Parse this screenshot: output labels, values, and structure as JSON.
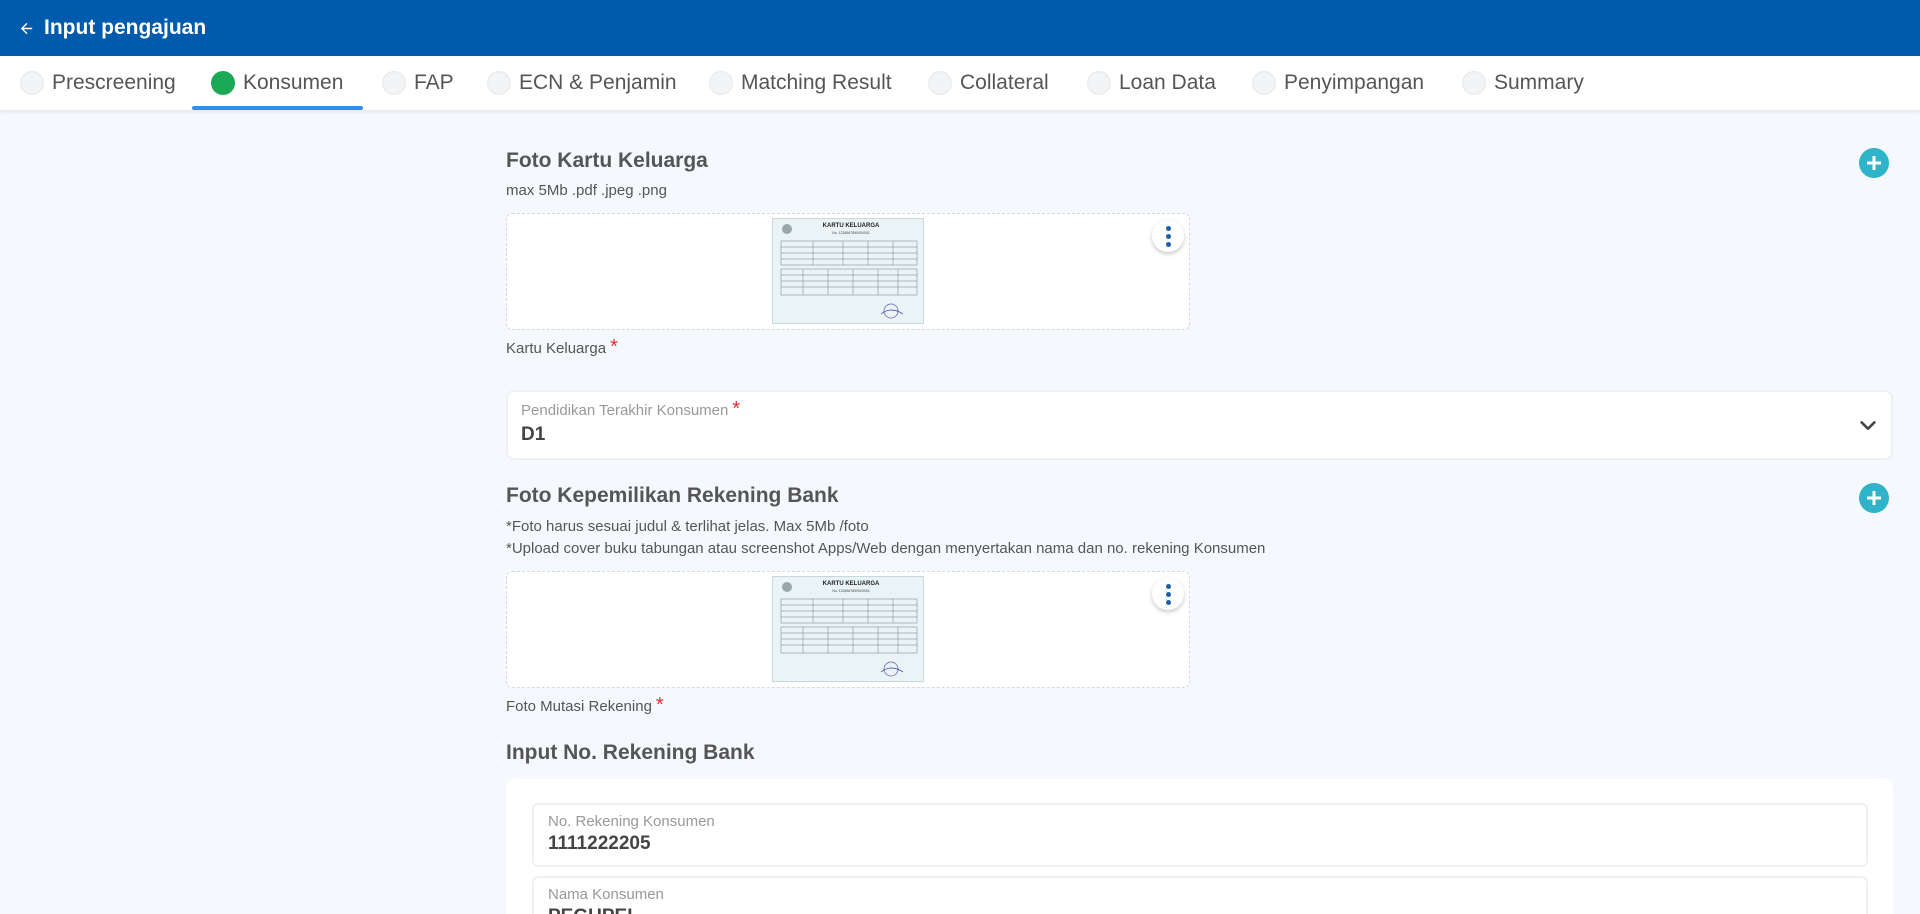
{
  "header": {
    "title": "Input pengajuan"
  },
  "tabs": [
    {
      "label": "Prescreening",
      "active": false
    },
    {
      "label": "Konsumen",
      "active": true
    },
    {
      "label": "FAP",
      "active": false
    },
    {
      "label": "ECN & Penjamin",
      "active": false
    },
    {
      "label": "Matching Result",
      "active": false
    },
    {
      "label": "Collateral",
      "active": false
    },
    {
      "label": "Loan Data",
      "active": false
    },
    {
      "label": "Penyimpangan",
      "active": false
    },
    {
      "label": "Summary",
      "active": false
    }
  ],
  "kk_section": {
    "title": "Foto Kartu Keluarga",
    "hint": "max 5Mb .pdf .jpeg .png",
    "caption": "Kartu Keluarga",
    "required_mark": "*"
  },
  "pendidikan": {
    "label": "Pendidikan Terakhir Konsumen",
    "required_mark": "*",
    "value": "D1"
  },
  "rekening_section": {
    "title": "Foto Kepemilikan Rekening Bank",
    "hint_1": "*Foto harus sesuai judul & terlihat jelas. Max 5Mb /foto",
    "hint_2": "*Upload cover buku tabungan atau screenshot Apps/Web dengan menyertakan nama dan no. rekening Konsumen",
    "caption": "Foto Mutasi Rekening",
    "required_mark": "*"
  },
  "input_rekening": {
    "title": "Input No. Rekening Bank",
    "no_rekening": {
      "label": "No. Rekening Konsumen",
      "value": "1111222205"
    },
    "nama": {
      "label": "Nama Konsumen",
      "value": "PEGUPEL"
    }
  },
  "document_thumb": {
    "doc_title": "KARTU KELUARGA",
    "doc_number": "No. 1234567890000001"
  },
  "colors": {
    "header_bg": "#005bac",
    "active_tab_dot": "#1aaa55",
    "tab_underline": "#2f8ee8",
    "add_button": "#2eb3c9",
    "required": "#e32d2d"
  },
  "icons": {
    "back": "arrow-left-icon",
    "add": "plus-circle-icon",
    "more": "more-vertical-icon",
    "dropdown": "chevron-down-icon"
  }
}
